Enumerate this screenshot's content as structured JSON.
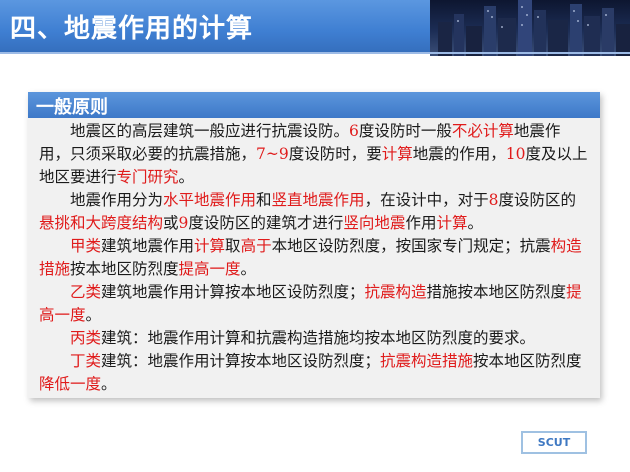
{
  "header": {
    "title": "四、地震作用的计算"
  },
  "section": {
    "title": "一般原则"
  },
  "para1": {
    "a": "地震区的高层建筑一般应进行抗震设防。",
    "b": "6",
    "c": "度设防时一般",
    "d": "不必计算",
    "e": "地震作用，只须采取必要的抗震措施，",
    "f": "7~9",
    "g": "度设防时，要",
    "h": "计算",
    "i": "地震的作用，",
    "j": "10",
    "k": "度及以上地区要进行",
    "l": "专门研究",
    "m": "。"
  },
  "para2": {
    "a": "地震作用分为",
    "b": "水平地震作用",
    "c": "和",
    "d": "竖直地震作用",
    "e": "，在设计中，对于",
    "f": "8",
    "g": "度设防区的",
    "h": "悬挑和大跨度结构",
    "i": "或",
    "j": "9",
    "k": "度设防区的建筑才进行",
    "l": "竖向地震",
    "m": "作用",
    "n": "计算",
    "o": "。"
  },
  "para3": {
    "a": "甲类",
    "b": "建筑地震作用",
    "c": "计算",
    "d": "取",
    "e": "高于",
    "f": "本地区设防烈度，按国家专门规定；抗震",
    "g": "构造措施",
    "h": "按本地区防烈度",
    "i": "提高一度",
    "j": "。"
  },
  "para4": {
    "a": "乙类",
    "b": "建筑地震作用计算按本地区设防烈度；",
    "c": "抗震构造",
    "d": "措施按本地区防烈度",
    "e": "提高一度",
    "f": "。"
  },
  "para5": {
    "a": "丙类",
    "b": "建筑：地震作用计算和抗震构造措施均按本地区防烈度的要求",
    "c": "。"
  },
  "para6": {
    "a": "丁类",
    "b": "建筑：地震作用计算按本地区设防烈度；",
    "c": "抗震构造措施",
    "d": "按本地区防烈度",
    "e": "降低一度",
    "f": "。"
  },
  "footer": {
    "logo": "SCUT"
  }
}
